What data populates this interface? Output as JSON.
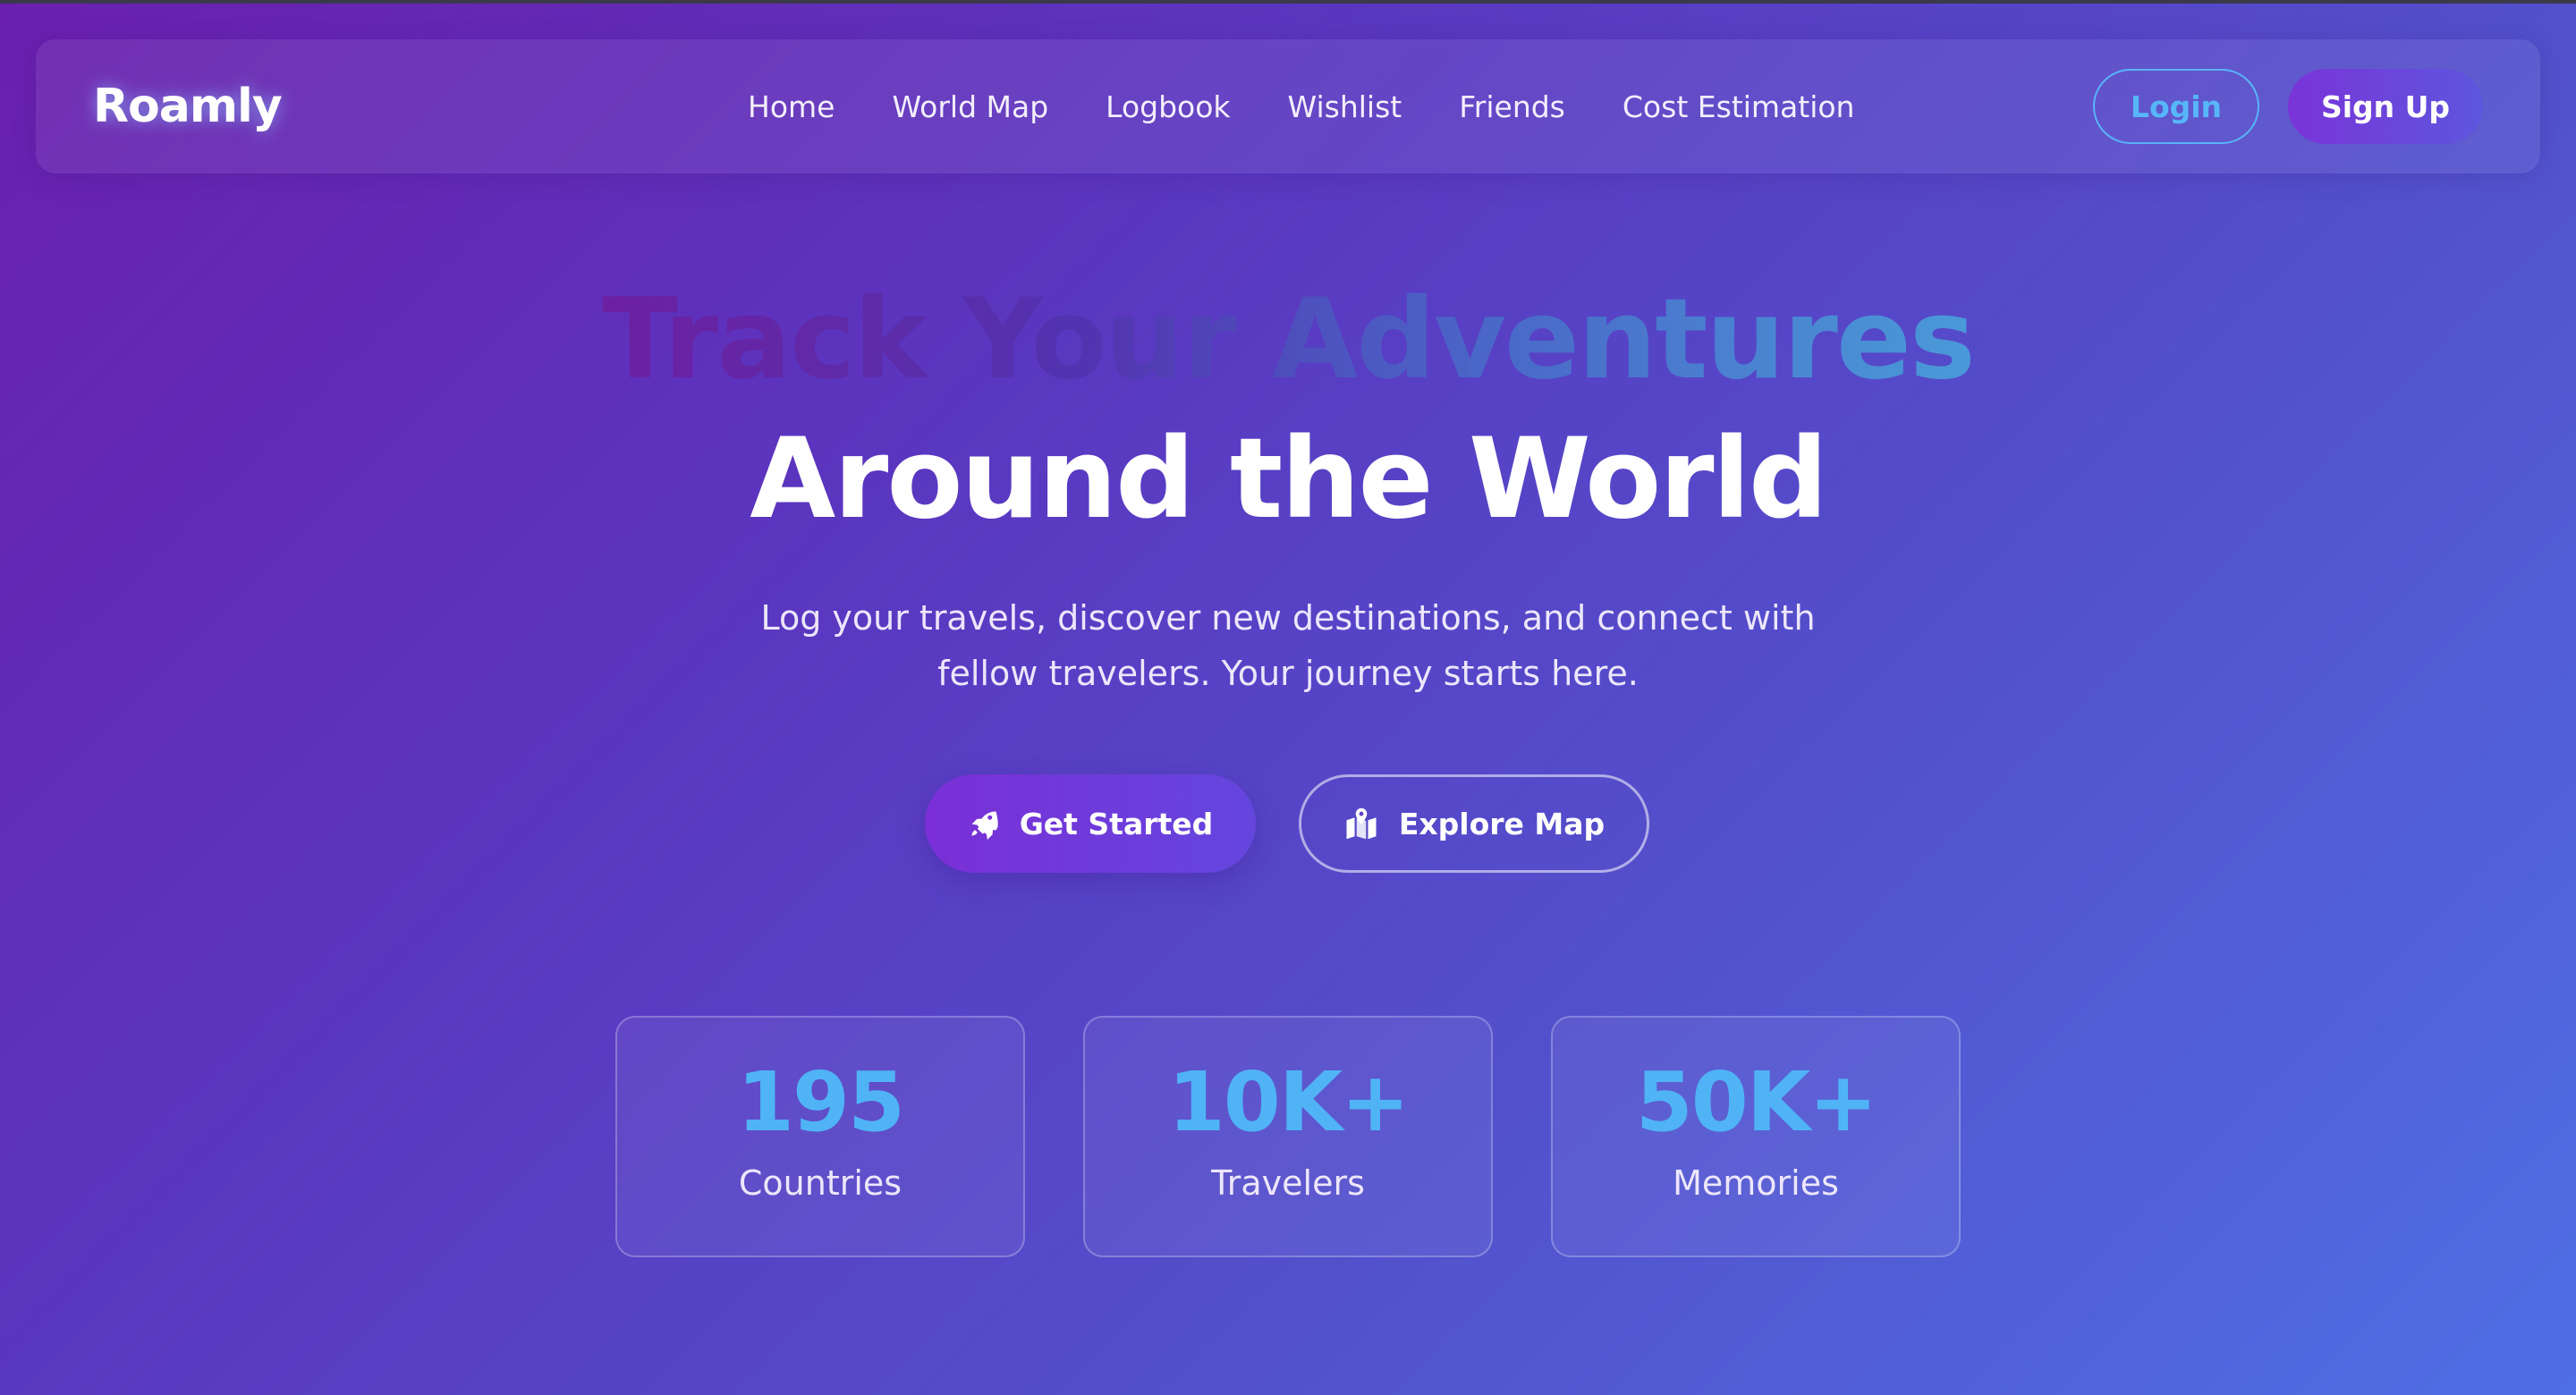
{
  "brand": {
    "name": "Roamly"
  },
  "nav": {
    "links": [
      {
        "label": "Home"
      },
      {
        "label": "World Map"
      },
      {
        "label": "Logbook"
      },
      {
        "label": "Wishlist"
      },
      {
        "label": "Friends"
      },
      {
        "label": "Cost Estimation"
      }
    ],
    "login_label": "Login",
    "signup_label": "Sign Up"
  },
  "hero": {
    "title_line1": "Track Your Adventures",
    "title_line2": "Around the World",
    "subtitle": "Log your travels, discover new destinations, and connect with fellow travelers. Your journey starts here.",
    "primary_button": {
      "label": "Get Started",
      "icon": "rocket-icon"
    },
    "secondary_button": {
      "label": "Explore Map",
      "icon": "map-marked-icon"
    }
  },
  "stats": [
    {
      "value": "195",
      "label": "Countries"
    },
    {
      "value": "10K+",
      "label": "Travelers"
    },
    {
      "value": "50K+",
      "label": "Memories"
    }
  ],
  "colors": {
    "accent_blue": "#4fb3f6",
    "button_purple": "#7a2fd6",
    "background_start": "#6a1fae",
    "background_end": "#4f6fe4"
  }
}
